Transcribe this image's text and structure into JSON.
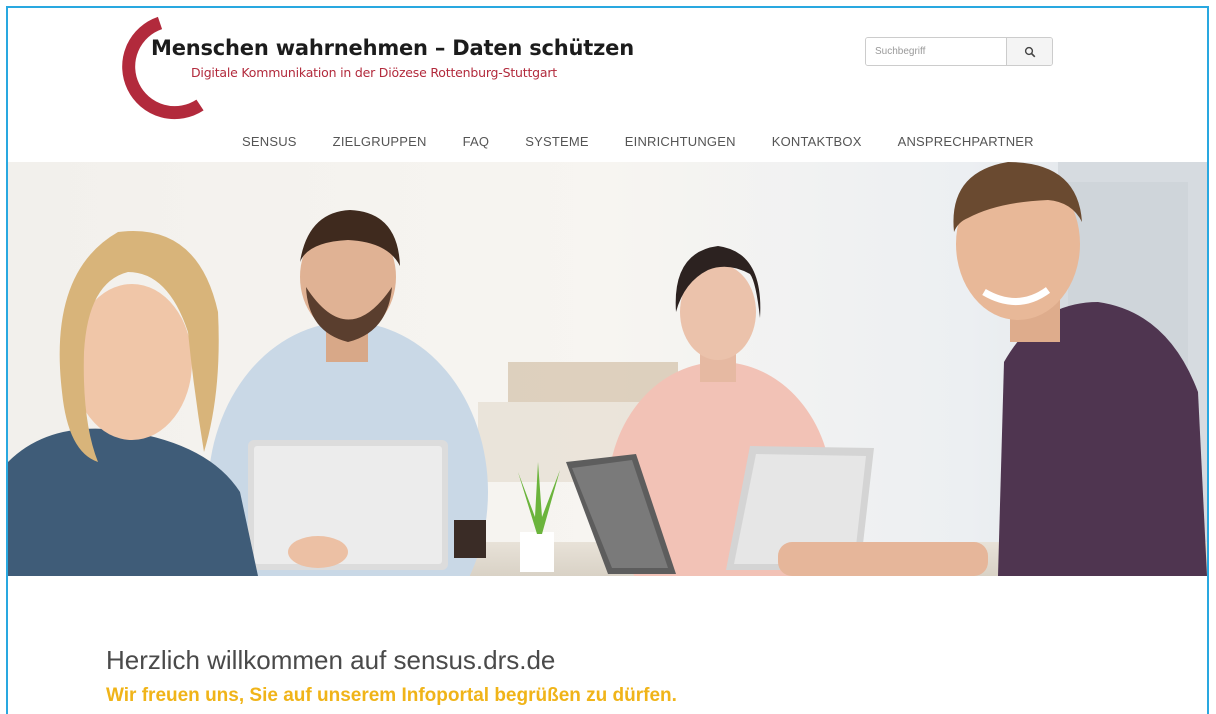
{
  "header": {
    "title": "Menschen wahrnehmen – Daten schützen",
    "subtitle": "Digitale Kommunikation in der Diözese Rottenburg-Stuttgart",
    "brand_color": "#b22a3c"
  },
  "search": {
    "placeholder": "Suchbegriff",
    "icon": "search-icon"
  },
  "nav": {
    "items": [
      {
        "label": "SENSUS"
      },
      {
        "label": "ZIELGRUPPEN"
      },
      {
        "label": "FAQ"
      },
      {
        "label": "SYSTEME"
      },
      {
        "label": "EINRICHTUNGEN"
      },
      {
        "label": "KONTAKTBOX"
      },
      {
        "label": "ANSPRECHPARTNER"
      }
    ]
  },
  "main": {
    "welcome": "Herzlich willkommen auf sensus.drs.de",
    "tagline": "Wir freuen uns, Sie auf unserem Infoportal begrüßen zu dürfen.",
    "tagline_color": "#f0b419"
  },
  "colors": {
    "frame_border": "#29a8e0",
    "heading_text": "#4a4a4a"
  }
}
